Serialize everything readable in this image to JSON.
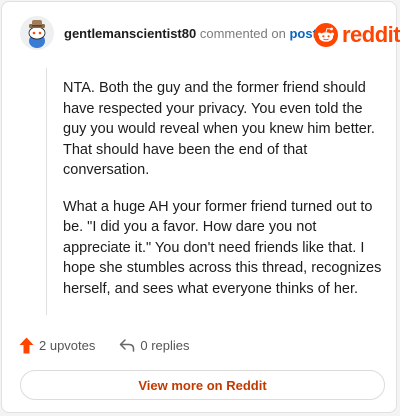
{
  "header": {
    "username": "gentlemanscientist80",
    "action_text": "commented on",
    "post_link": "post"
  },
  "brand": {
    "name": "reddit",
    "color": "#ff4500"
  },
  "comment": {
    "paragraphs": [
      "NTA. Both the guy and the former friend should have respected your privacy. You even told the guy you would reveal when you knew him better. That should have been the end of that conversation.",
      "What a huge AH your former friend turned out to be. \"I did you a favor. How dare you not appreciate it.\" You don't need friends like that. I hope she stumbles across this thread, recognizes herself, and sees what everyone thinks of her."
    ]
  },
  "footer": {
    "upvotes_label": "2 upvotes",
    "replies_label": "0 replies",
    "view_more_label": "View more on Reddit",
    "upvote_icon": "upvote-arrow-icon",
    "reply_icon": "reply-arrow-icon"
  }
}
